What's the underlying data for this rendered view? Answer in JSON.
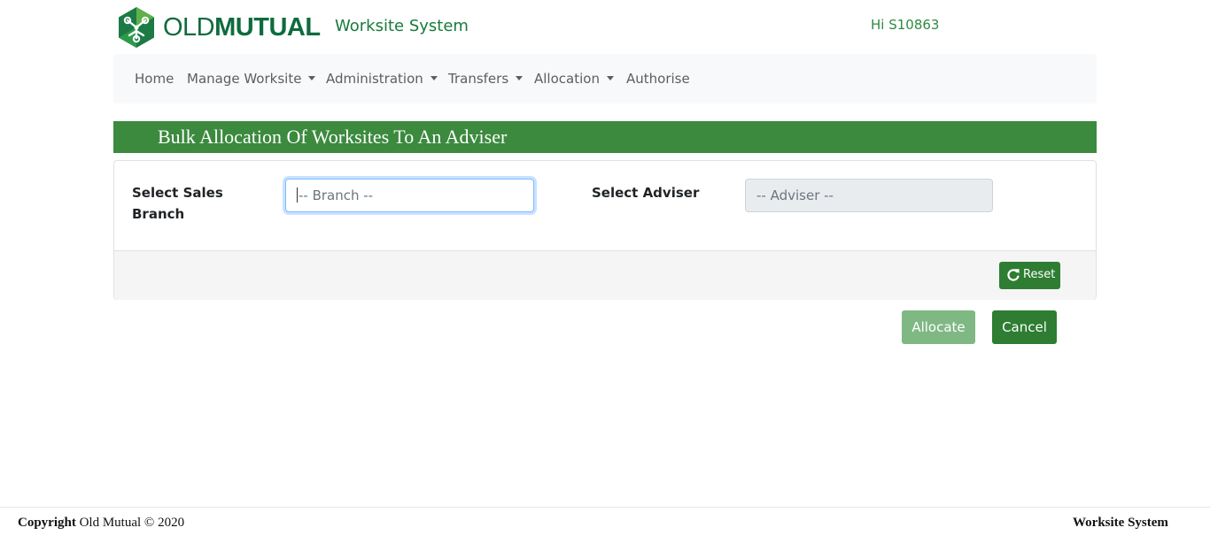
{
  "header": {
    "brand_part1": "OLD",
    "brand_part2": "MUTUAL",
    "app_title": "Worksite System",
    "greeting": "Hi S10863"
  },
  "nav": {
    "items": [
      {
        "label": "Home",
        "dropdown": false
      },
      {
        "label": "Manage Worksite",
        "dropdown": true
      },
      {
        "label": "Administration",
        "dropdown": true
      },
      {
        "label": "Transfers",
        "dropdown": true
      },
      {
        "label": "Allocation",
        "dropdown": true
      },
      {
        "label": "Authorise",
        "dropdown": false
      }
    ]
  },
  "page": {
    "title": "Bulk Allocation Of Worksites To An Adviser"
  },
  "form": {
    "branch_label_line1": "Select Sales",
    "branch_label_line2": "Branch",
    "branch_placeholder": "-- Branch --",
    "adviser_label": "Select Adviser",
    "adviser_placeholder": "-- Adviser --",
    "reset_label": "Reset"
  },
  "actions": {
    "allocate_label": "Allocate",
    "cancel_label": "Cancel"
  },
  "footer": {
    "copyright_word": "Copyright",
    "copyright_rest": "Old Mutual © 2020",
    "system_name": "Worksite System"
  },
  "colors": {
    "brand_green": "#0f6b3e",
    "banner_green": "#3b8a3e",
    "button_green": "#2e7d32",
    "button_disabled_green": "#7fb883",
    "focus_blue": "#80bdff"
  },
  "icons": {
    "logo": "old-mutual-logo",
    "reset": "refresh-icon",
    "dropdown": "caret-down-icon"
  }
}
